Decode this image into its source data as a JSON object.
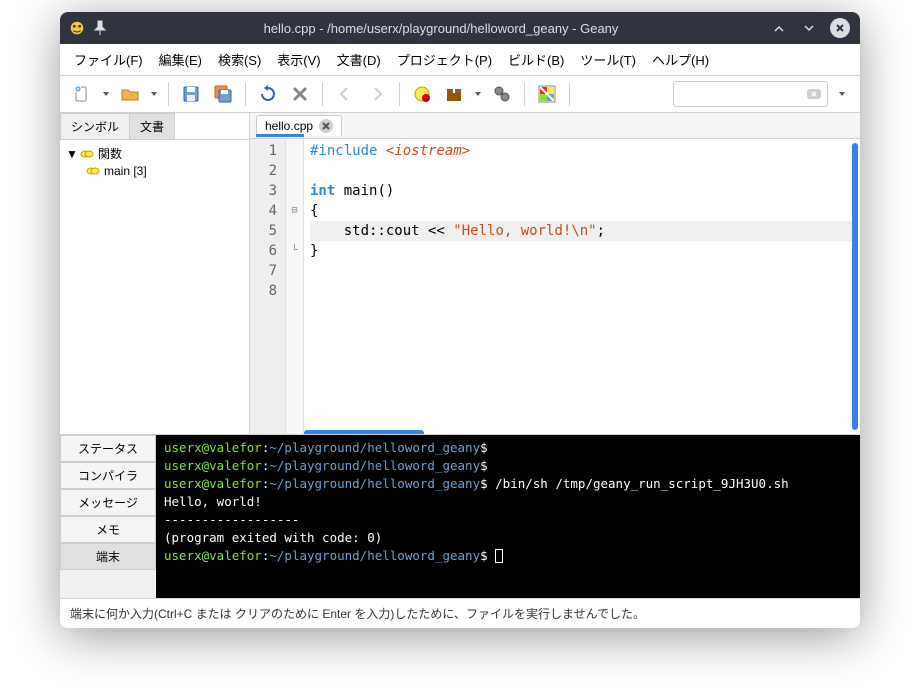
{
  "window": {
    "title": "hello.cpp - /home/userx/playground/helloword_geany - Geany"
  },
  "menubar": [
    "ファイル(F)",
    "編集(E)",
    "検索(S)",
    "表示(V)",
    "文書(D)",
    "プロジェクト(P)",
    "ビルド(B)",
    "ツール(T)",
    "ヘルプ(H)"
  ],
  "sidebar": {
    "tabs": [
      "シンボル",
      "文書"
    ],
    "active_tab": 1,
    "tree": {
      "root_label": "関数",
      "items": [
        "main [3]"
      ]
    }
  },
  "editor": {
    "tab_label": "hello.cpp",
    "lines": [
      {
        "n": "1",
        "parts": [
          {
            "t": "#include ",
            "c": "kw-pp"
          },
          {
            "t": "<iostream>",
            "c": "kw-inc"
          }
        ]
      },
      {
        "n": "2",
        "parts": []
      },
      {
        "n": "3",
        "parts": [
          {
            "t": "int",
            "c": "kw-type"
          },
          {
            "t": " main()",
            "c": ""
          }
        ]
      },
      {
        "n": "4",
        "parts": [
          {
            "t": "{",
            "c": ""
          }
        ],
        "fold": "⊟"
      },
      {
        "n": "5",
        "parts": [
          {
            "t": "    std::cout << ",
            "c": ""
          },
          {
            "t": "\"Hello, world!\\n\"",
            "c": "kw-str"
          },
          {
            "t": ";",
            "c": ""
          }
        ],
        "hl": true
      },
      {
        "n": "6",
        "parts": [
          {
            "t": "}",
            "c": ""
          }
        ],
        "fold": "└"
      },
      {
        "n": "7",
        "parts": []
      },
      {
        "n": "8",
        "parts": []
      }
    ]
  },
  "bottom": {
    "tabs": [
      "ステータス",
      "コンパイラ",
      "メッセージ",
      "メモ",
      "端末"
    ],
    "active": 4,
    "terminal_lines": [
      {
        "prompt_user": "userx@valefor",
        "prompt_path": "~/playground/helloword_geany",
        "cmd": ""
      },
      {
        "prompt_user": "userx@valefor",
        "prompt_path": "~/playground/helloword_geany",
        "cmd": ""
      },
      {
        "prompt_user": "userx@valefor",
        "prompt_path": "~/playground/helloword_geany",
        "cmd": " /bin/sh /tmp/geany_run_script_9JH3U0.sh"
      },
      {
        "text": "Hello, world!"
      },
      {
        "text": ""
      },
      {
        "text": "------------------"
      },
      {
        "text": "(program exited with code: 0)"
      },
      {
        "prompt_user": "userx@valefor",
        "prompt_path": "~/playground/helloword_geany",
        "cmd": " ",
        "cursor": true
      }
    ]
  },
  "statusbar": "端末に何か入力(Ctrl+C または クリアのために Enter を入力)したために、ファイルを実行しませんでした。",
  "search_placeholder": ""
}
